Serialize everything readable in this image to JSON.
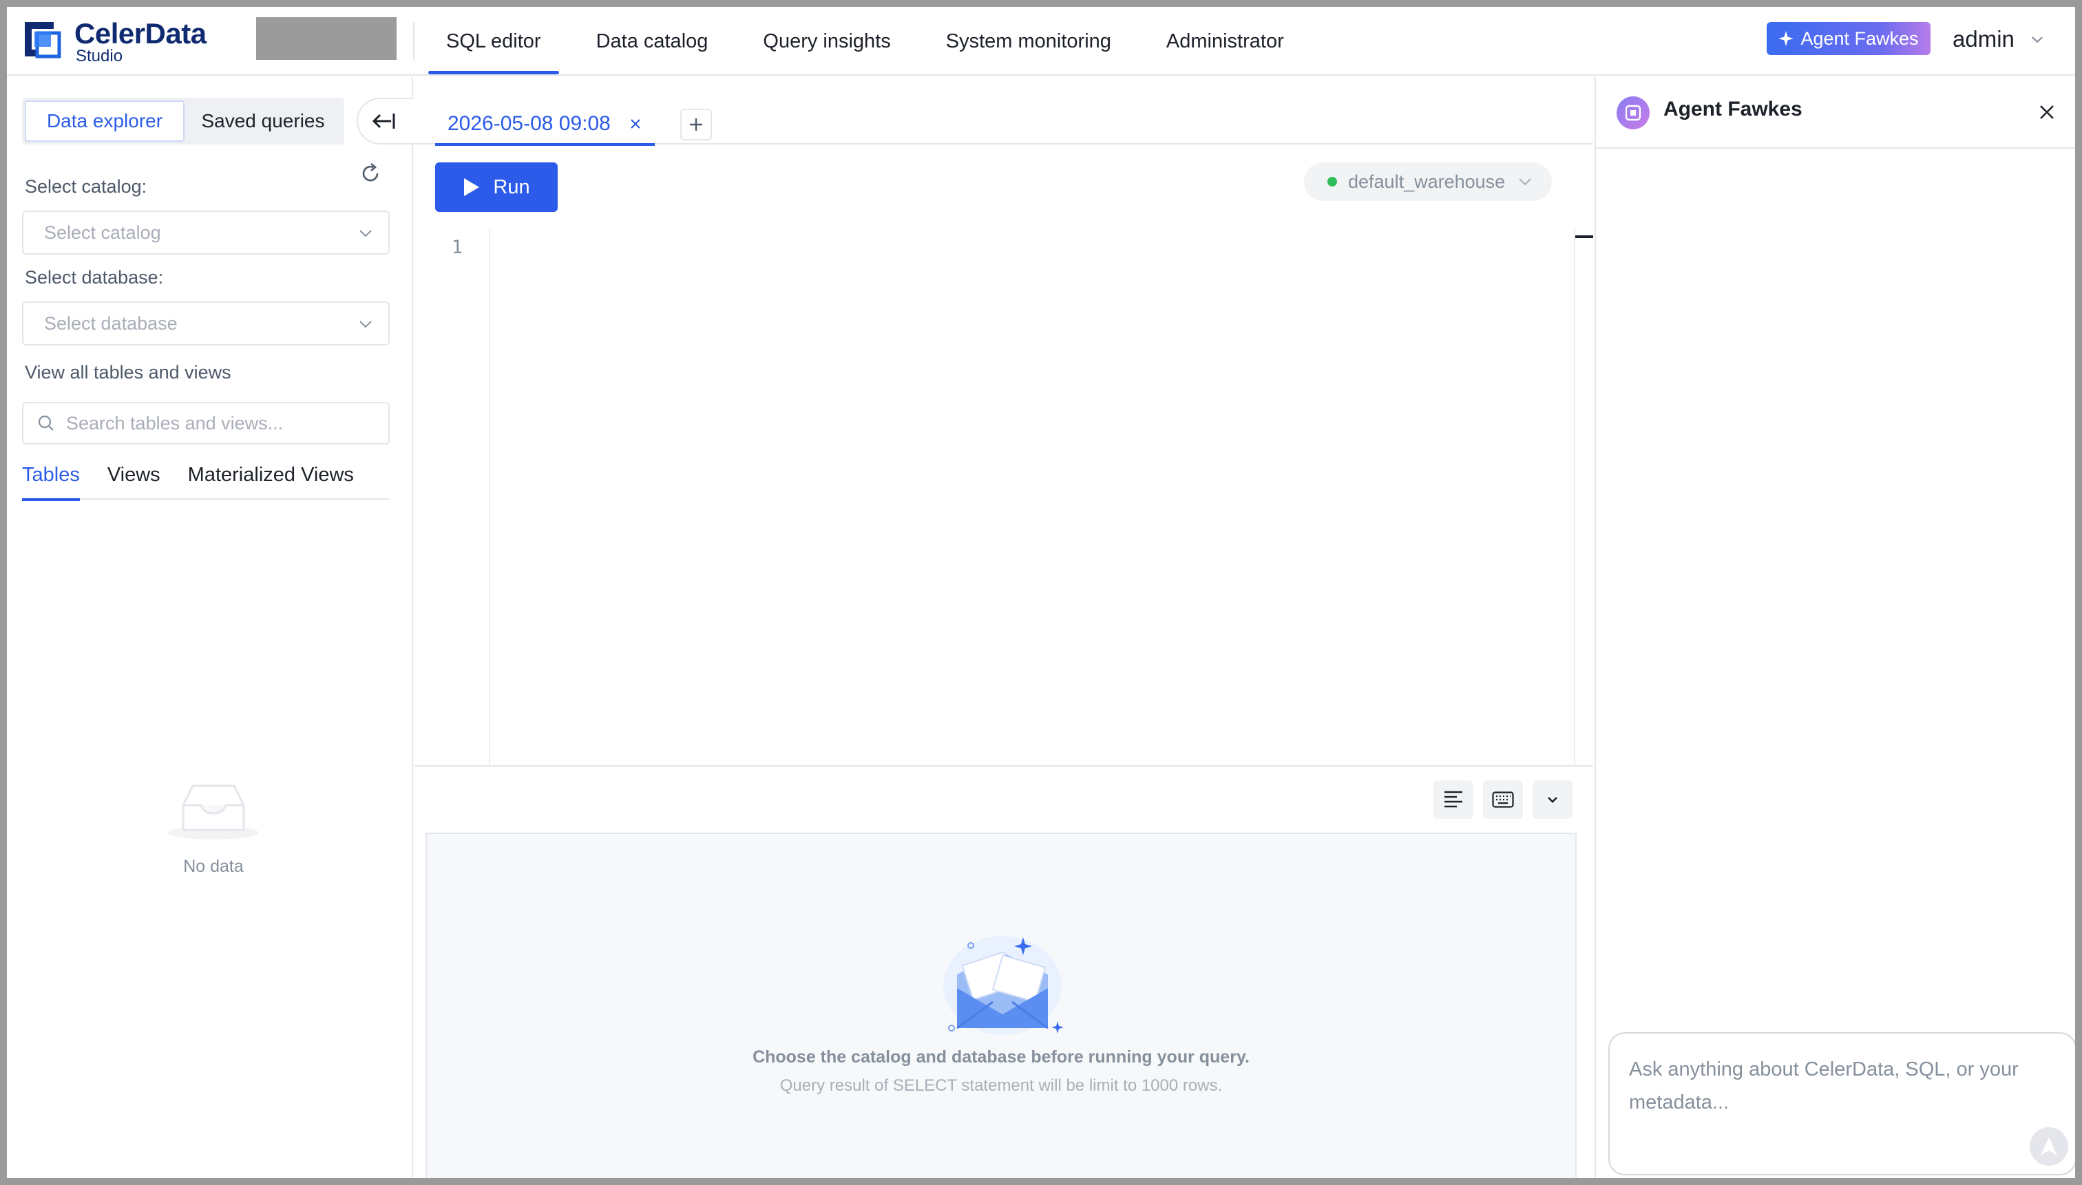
{
  "app": {
    "brand_name": "CelerData",
    "brand_sub": "Studio"
  },
  "nav": {
    "items": [
      {
        "label": "SQL editor",
        "active": true
      },
      {
        "label": "Data catalog",
        "active": false
      },
      {
        "label": "Query insights",
        "active": false
      },
      {
        "label": "System monitoring",
        "active": false
      },
      {
        "label": "Administrator",
        "active": false
      }
    ],
    "agent_button": "Agent Fawkes",
    "user": "admin"
  },
  "left": {
    "segments": [
      "Data explorer",
      "Saved queries"
    ],
    "active_segment": "Data explorer",
    "catalog_label": "Select catalog:",
    "catalog_placeholder": "Select catalog",
    "database_label": "Select database:",
    "database_placeholder": "Select database",
    "view_all_label": "View all tables and views",
    "search_placeholder": "Search tables and views...",
    "tabs": [
      "Tables",
      "Views",
      "Materialized Views"
    ],
    "active_tab": "Tables",
    "empty_text": "No data"
  },
  "editor": {
    "tab_label": "2026-05-08 09:08",
    "run_label": "Run",
    "warehouse": "default_warehouse",
    "line_numbers": [
      "1"
    ],
    "result_message": "Choose the catalog and database before running your query.",
    "result_hint": "Query result of SELECT statement will be limit to 1000 rows."
  },
  "agent": {
    "title": "Agent Fawkes",
    "input_placeholder": "Ask anything about CelerData, SQL, or your metadata..."
  },
  "colors": {
    "accent": "#2b5be8",
    "brand_navy": "#0f2a70",
    "status_green": "#2ebd5a"
  },
  "icons": {
    "refresh": "refresh-icon",
    "collapse": "collapse-left-icon",
    "search": "search-icon",
    "format": "align-left-icon",
    "keyboard": "keyboard-icon",
    "more": "chevron-down-icon",
    "send": "send-icon",
    "close": "close-icon"
  }
}
